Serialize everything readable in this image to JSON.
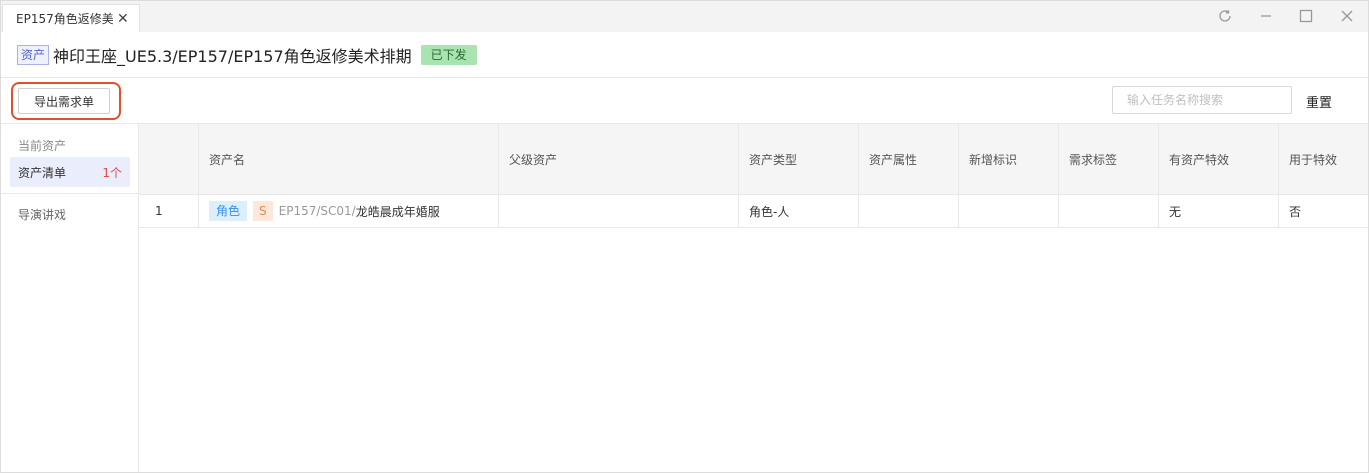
{
  "tab": {
    "title": "EP157角色返修美",
    "close_label": "✕"
  },
  "window_controls": [
    {
      "name": "refresh-icon",
      "glyph": "↻"
    },
    {
      "name": "minimize-icon",
      "glyph": "—"
    },
    {
      "name": "maximize-icon",
      "glyph": "☐"
    },
    {
      "name": "close-window-icon",
      "glyph": "✕"
    }
  ],
  "header": {
    "asset_tag": "资产",
    "title": "神印王座_UE5.3/EP157/EP157角色返修美术排期",
    "status": "已下发"
  },
  "toolbar": {
    "export_label": "导出需求单",
    "search_placeholder": "输入任务名称搜索",
    "reset_label": "重置"
  },
  "sidebar": {
    "heading": "当前资产",
    "items": [
      {
        "label": "资产清单",
        "count": "1个"
      },
      {
        "label": "导演讲戏"
      }
    ]
  },
  "table": {
    "columns": [
      "",
      "资产名",
      "父级资产",
      "资产类型",
      "资产属性",
      "新增标识",
      "需求标签",
      "有资产特效",
      "用于特效"
    ],
    "rows": [
      {
        "index": "1",
        "type_tag": "角色",
        "level_tag": "S",
        "path_prefix": "EP157/SC01/",
        "path_name": "龙皓晨成年婚服",
        "parent": "",
        "asset_type": "角色-人",
        "attribute": "",
        "new_flag": "",
        "req_tag": "",
        "has_vfx": "无",
        "for_vfx": "否"
      }
    ]
  },
  "colors": {
    "highlight": "#e0502f",
    "sidebar_active_bg": "#eaedfb",
    "count_red": "#e04a4a",
    "status_green": "#a9e3b1"
  }
}
